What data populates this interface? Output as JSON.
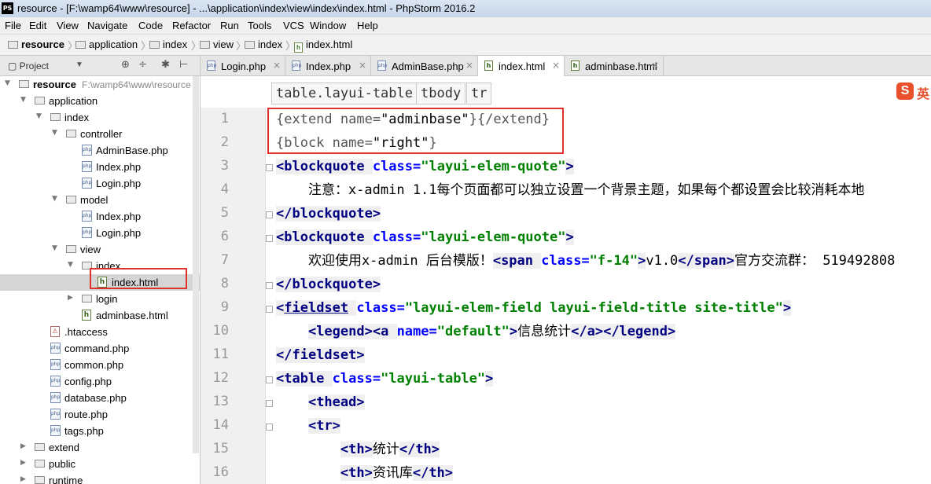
{
  "titlebar": {
    "app_icon": "PS",
    "title": "resource - [F:\\wamp64\\www\\resource] - ...\\application\\index\\view\\index\\index.html - PhpStorm 2016.2"
  },
  "menu": [
    "File",
    "Edit",
    "View",
    "Navigate",
    "Code",
    "Refactor",
    "Run",
    "Tools",
    "VCS",
    "Window",
    "Help"
  ],
  "breadcrumb": [
    "resource",
    "application",
    "index",
    "view",
    "index",
    "index.html"
  ],
  "project_panel": {
    "label": "Project",
    "dropdown": "▼",
    "tools": [
      "⊕",
      "÷",
      "✱",
      "⊢"
    ]
  },
  "tree": [
    {
      "label": "resource",
      "sub": "F:\\wamp64\\www\\resource",
      "type": "folder",
      "bold": true,
      "arrow": "▼"
    },
    {
      "label": "application",
      "type": "folder",
      "arrow": "▼"
    },
    {
      "label": "index",
      "type": "folder",
      "arrow": "▼"
    },
    {
      "label": "controller",
      "type": "folder",
      "arrow": "▼"
    },
    {
      "label": "AdminBase.php",
      "type": "php"
    },
    {
      "label": "Index.php",
      "type": "php"
    },
    {
      "label": "Login.php",
      "type": "php"
    },
    {
      "label": "model",
      "type": "folder",
      "arrow": "▼"
    },
    {
      "label": "Index.php",
      "type": "php"
    },
    {
      "label": "Login.php",
      "type": "php"
    },
    {
      "label": "view",
      "type": "folder",
      "arrow": "▼"
    },
    {
      "label": "index",
      "type": "folder",
      "arrow": "▼"
    },
    {
      "label": "index.html",
      "type": "html",
      "selected": true
    },
    {
      "label": "login",
      "type": "folder",
      "arrow": "▶"
    },
    {
      "label": "adminbase.html",
      "type": "html"
    },
    {
      "label": ".htaccess",
      "type": "ht"
    },
    {
      "label": "command.php",
      "type": "php"
    },
    {
      "label": "common.php",
      "type": "php"
    },
    {
      "label": "config.php",
      "type": "php"
    },
    {
      "label": "database.php",
      "type": "php"
    },
    {
      "label": "route.php",
      "type": "php"
    },
    {
      "label": "tags.php",
      "type": "php"
    },
    {
      "label": "extend",
      "type": "folder",
      "arrow": "▶"
    },
    {
      "label": "public",
      "type": "folder",
      "arrow": "▶"
    },
    {
      "label": "runtime",
      "type": "folder",
      "arrow": "▶"
    }
  ],
  "tabs": [
    {
      "label": "Login.php",
      "icon": "php"
    },
    {
      "label": "Index.php",
      "icon": "php"
    },
    {
      "label": "AdminBase.php",
      "icon": "php"
    },
    {
      "label": "index.html",
      "icon": "html",
      "active": true
    },
    {
      "label": "adminbase.html",
      "icon": "html"
    }
  ],
  "tab_close": "×",
  "editor_breadcrumb": [
    "table.layui-table",
    "tbody",
    "tr"
  ],
  "sogou": {
    "s": "S",
    "y": "英"
  },
  "line_numbers": [
    "1",
    "2",
    "3",
    "4",
    "5",
    "6",
    "7",
    "8",
    "9",
    "10",
    "11",
    "12",
    "13",
    "14",
    "15",
    "16"
  ],
  "code_lines": [
    [
      {
        "t": "{extend name=",
        "c": "tpl"
      },
      {
        "t": "\"adminbase\"",
        "c": "tplstr"
      },
      {
        "t": "}{/extend}",
        "c": "tpl"
      }
    ],
    [
      {
        "t": "{block name=",
        "c": "tpl"
      },
      {
        "t": "\"right\"",
        "c": "tplstr"
      },
      {
        "t": "}",
        "c": "tpl"
      }
    ],
    [
      {
        "t": "<blockquote ",
        "c": "tag"
      },
      {
        "t": "class=",
        "c": "attr"
      },
      {
        "t": "\"layui-elem-quote\"",
        "c": "str"
      },
      {
        "t": ">",
        "c": "tag"
      }
    ],
    [
      {
        "t": "    注意：x-admin 1.1每个页面都可以独立设置一个背景主题，如果每个都设置会比较消耗本地",
        "c": "txt"
      }
    ],
    [
      {
        "t": "</blockquote>",
        "c": "tag"
      }
    ],
    [
      {
        "t": "<blockquote ",
        "c": "tag"
      },
      {
        "t": "class=",
        "c": "attr"
      },
      {
        "t": "\"layui-elem-quote\"",
        "c": "str"
      },
      {
        "t": ">",
        "c": "tag"
      }
    ],
    [
      {
        "t": "    欢迎使用x-admin 后台模版！",
        "c": "txt"
      },
      {
        "t": "<span ",
        "c": "tag"
      },
      {
        "t": "class=",
        "c": "attr"
      },
      {
        "t": "\"f-14\"",
        "c": "str"
      },
      {
        "t": ">",
        "c": "tag"
      },
      {
        "t": "v1.0",
        "c": "txt"
      },
      {
        "t": "</span>",
        "c": "tag"
      },
      {
        "t": "官方交流群： 519492808",
        "c": "txt"
      }
    ],
    [
      {
        "t": "</blockquote>",
        "c": "tag"
      }
    ],
    [
      {
        "t": "<",
        "c": "tag"
      },
      {
        "t": "fieldset",
        "c": "tag u"
      },
      {
        "t": " ",
        "c": "tag"
      },
      {
        "t": "class=",
        "c": "attr"
      },
      {
        "t": "\"layui-elem-field layui-field-title site-title\"",
        "c": "str"
      },
      {
        "t": ">",
        "c": "tag"
      }
    ],
    [
      {
        "t": "    ",
        "c": "txt"
      },
      {
        "t": "<legend>",
        "c": "tag"
      },
      {
        "t": "<a ",
        "c": "tag"
      },
      {
        "t": "name=",
        "c": "attr"
      },
      {
        "t": "\"default\"",
        "c": "str"
      },
      {
        "t": ">",
        "c": "tag"
      },
      {
        "t": "信息统计",
        "c": "txt"
      },
      {
        "t": "</a>",
        "c": "tag"
      },
      {
        "t": "</legend>",
        "c": "tag"
      }
    ],
    [
      {
        "t": "</fieldset>",
        "c": "tag"
      }
    ],
    [
      {
        "t": "<table ",
        "c": "tag"
      },
      {
        "t": "class=",
        "c": "attr"
      },
      {
        "t": "\"layui-table\"",
        "c": "str"
      },
      {
        "t": ">",
        "c": "tag"
      }
    ],
    [
      {
        "t": "    ",
        "c": "txt"
      },
      {
        "t": "<thead>",
        "c": "tag"
      }
    ],
    [
      {
        "t": "    ",
        "c": "txt"
      },
      {
        "t": "<tr>",
        "c": "tag"
      }
    ],
    [
      {
        "t": "        ",
        "c": "txt"
      },
      {
        "t": "<th>",
        "c": "tag"
      },
      {
        "t": "统计",
        "c": "txt"
      },
      {
        "t": "</th>",
        "c": "tag"
      }
    ],
    [
      {
        "t": "        ",
        "c": "txt"
      },
      {
        "t": "<th>",
        "c": "tag"
      },
      {
        "t": "资讯库",
        "c": "txt"
      },
      {
        "t": "</th>",
        "c": "tag"
      }
    ]
  ]
}
